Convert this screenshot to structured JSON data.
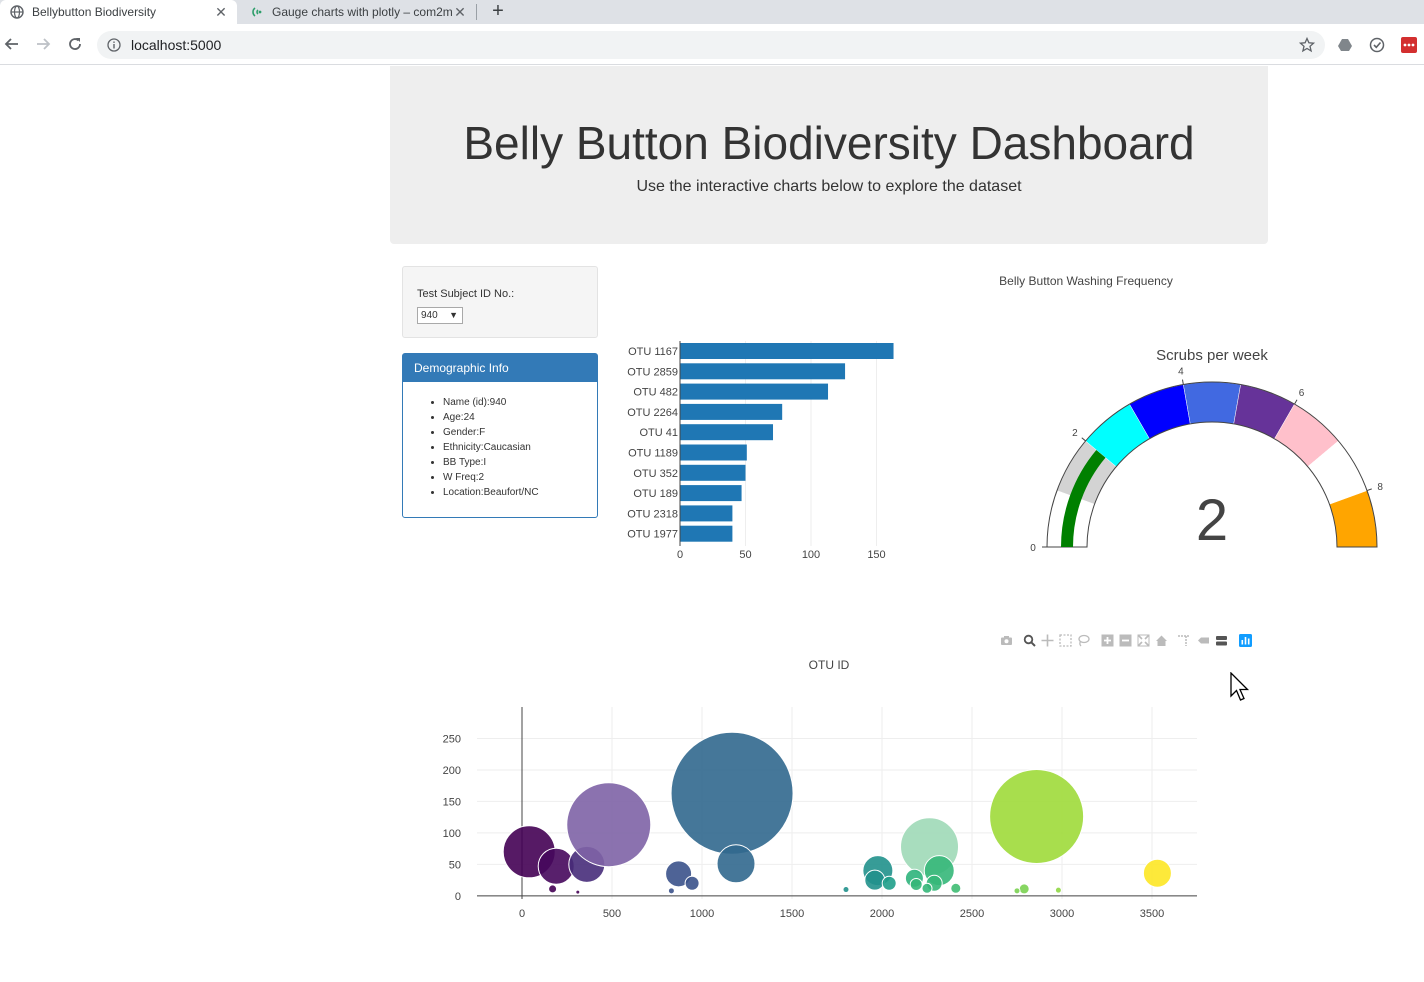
{
  "browser": {
    "tabs": [
      {
        "title": "Bellybutton Biodiversity",
        "active": true
      },
      {
        "title": "Gauge charts with plotly – com2m",
        "active": false
      }
    ],
    "url": "localhost:5000"
  },
  "header": {
    "title": "Belly Button Biodiversity Dashboard",
    "subtitle": "Use the interactive charts below to explore the dataset"
  },
  "selector": {
    "label": "Test Subject ID No.:",
    "selected": "940"
  },
  "demographics": {
    "title": "Demographic Info",
    "items": [
      "Name (id):940",
      "Age:24",
      "Gender:F",
      "Ethnicity:Caucasian",
      "BB Type:I",
      "W Freq:2",
      "Location:Beaufort/NC"
    ]
  },
  "colors": {
    "bar": "#1f77b4",
    "panel_blue": "#337ab7",
    "jumbotron": "#eeeeee"
  },
  "chart_data": [
    {
      "type": "bar",
      "orientation": "horizontal",
      "categories": [
        "OTU 1167",
        "OTU 2859",
        "OTU 482",
        "OTU 2264",
        "OTU 41",
        "OTU 1189",
        "OTU 352",
        "OTU 189",
        "OTU 2318",
        "OTU 1977"
      ],
      "values": [
        163,
        126,
        113,
        78,
        71,
        51,
        50,
        47,
        40,
        40
      ],
      "xlim": [
        0,
        163
      ],
      "xticks": [
        0,
        50,
        100,
        150
      ]
    },
    {
      "type": "gauge",
      "title": "Belly Button Washing Frequency",
      "subtitle": "Scrubs per week",
      "value": 2,
      "range": [
        0,
        9
      ],
      "tick_labels": [
        "0",
        "2",
        "4",
        "6",
        "8"
      ],
      "steps": [
        {
          "range": [
            0,
            1
          ],
          "color": "#ffffff"
        },
        {
          "range": [
            1,
            2
          ],
          "color": "#d3d3d3"
        },
        {
          "range": [
            2,
            3
          ],
          "color": "#00ffff"
        },
        {
          "range": [
            3,
            4
          ],
          "color": "#0000ff"
        },
        {
          "range": [
            4,
            5
          ],
          "color": "#4169e1"
        },
        {
          "range": [
            5,
            6
          ],
          "color": "#663399"
        },
        {
          "range": [
            6,
            7
          ],
          "color": "#ffc0cb"
        },
        {
          "range": [
            7,
            8
          ],
          "color": "#ffffff"
        },
        {
          "range": [
            8,
            9
          ],
          "color": "#ffa500"
        }
      ],
      "bar_color": "#008000"
    },
    {
      "type": "bubble",
      "title": "OTU ID",
      "xticks": [
        0,
        500,
        1000,
        1500,
        2000,
        2500,
        3000,
        3500
      ],
      "yticks": [
        0,
        50,
        100,
        150,
        200,
        250
      ],
      "xlim": [
        -250,
        3750
      ],
      "ylim": [
        -5,
        300
      ],
      "points": [
        {
          "x": 40,
          "y": 70,
          "r": 26,
          "color": "#440154"
        },
        {
          "x": 190,
          "y": 47,
          "r": 18,
          "color": "#46085c"
        },
        {
          "x": 360,
          "y": 50,
          "r": 18,
          "color": "#472c7a"
        },
        {
          "x": 482,
          "y": 113,
          "r": 42,
          "color": "#7e63a6"
        },
        {
          "x": 170,
          "y": 11,
          "r": 4,
          "color": "#440154"
        },
        {
          "x": 310,
          "y": 6,
          "r": 2,
          "color": "#440154"
        },
        {
          "x": 870,
          "y": 35,
          "r": 13,
          "color": "#3b528b"
        },
        {
          "x": 945,
          "y": 20,
          "r": 7,
          "color": "#3b528b"
        },
        {
          "x": 830,
          "y": 8,
          "r": 3,
          "color": "#3b528b"
        },
        {
          "x": 1167,
          "y": 163,
          "r": 61,
          "color": "#31688e"
        },
        {
          "x": 1189,
          "y": 51,
          "r": 19,
          "color": "#31688e"
        },
        {
          "x": 1800,
          "y": 10,
          "r": 3,
          "color": "#21918c"
        },
        {
          "x": 1977,
          "y": 40,
          "r": 15,
          "color": "#21918c"
        },
        {
          "x": 1960,
          "y": 25,
          "r": 10,
          "color": "#21918c"
        },
        {
          "x": 2040,
          "y": 20,
          "r": 7,
          "color": "#1f9e89"
        },
        {
          "x": 2264,
          "y": 78,
          "r": 29,
          "color": "#9ed9b7"
        },
        {
          "x": 2318,
          "y": 40,
          "r": 15,
          "color": "#35b779"
        },
        {
          "x": 2180,
          "y": 28,
          "r": 9,
          "color": "#2fb47c"
        },
        {
          "x": 2290,
          "y": 20,
          "r": 8,
          "color": "#35b779"
        },
        {
          "x": 2190,
          "y": 18,
          "r": 6,
          "color": "#35b779"
        },
        {
          "x": 2250,
          "y": 12,
          "r": 5,
          "color": "#35b779"
        },
        {
          "x": 2410,
          "y": 12,
          "r": 5,
          "color": "#3fbc73"
        },
        {
          "x": 2859,
          "y": 126,
          "r": 47,
          "color": "#9fda3a"
        },
        {
          "x": 2790,
          "y": 11,
          "r": 5,
          "color": "#7ad151"
        },
        {
          "x": 2750,
          "y": 8,
          "r": 3,
          "color": "#7ad151"
        },
        {
          "x": 2980,
          "y": 9,
          "r": 3,
          "color": "#8fd744"
        },
        {
          "x": 3530,
          "y": 36,
          "r": 14,
          "color": "#fde725"
        }
      ]
    }
  ]
}
